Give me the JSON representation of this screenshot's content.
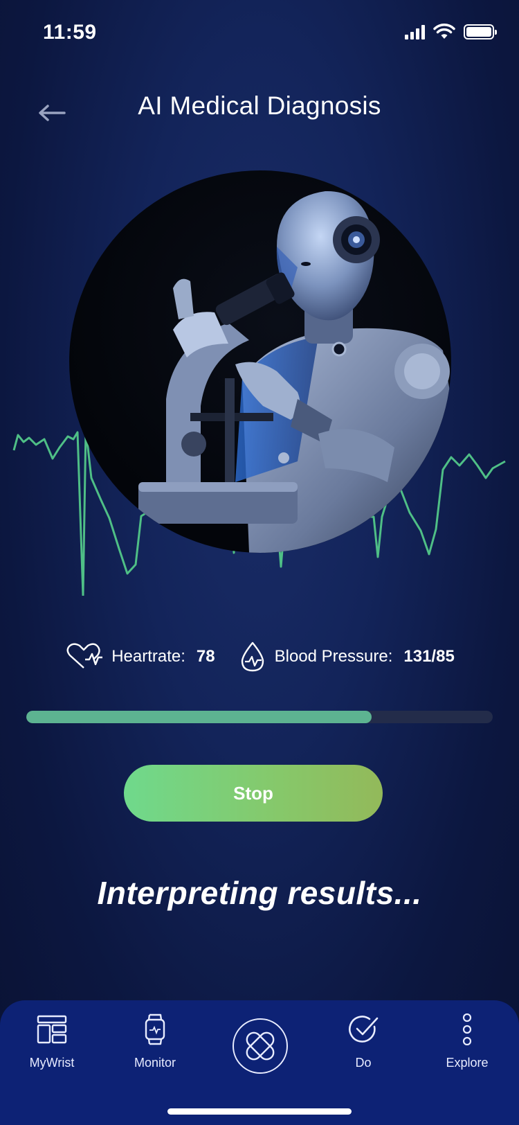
{
  "status_bar": {
    "time": "11:59"
  },
  "header": {
    "title": "AI Medical Diagnosis"
  },
  "vitals": {
    "heartrate_label": "Heartrate:",
    "heartrate_value": "78",
    "blood_pressure_label": "Blood Pressure:",
    "blood_pressure_value": "131/85"
  },
  "progress": {
    "fraction": 0.74
  },
  "actions": {
    "stop_label": "Stop"
  },
  "status_message": "Interpreting results...",
  "tab_bar": {
    "items": [
      {
        "label": "MyWrist",
        "icon": "dashboard-icon"
      },
      {
        "label": "Monitor",
        "icon": "smartwatch-icon"
      },
      {
        "label": "",
        "icon": "bandage-icon"
      },
      {
        "label": "Do",
        "icon": "check-circle-icon"
      },
      {
        "label": "Explore",
        "icon": "more-vertical-icon"
      }
    ]
  },
  "colors": {
    "background": "#13245a",
    "accent_green": "#5db391",
    "ecg_line": "#4fbf86",
    "tab_bar": "#0d2275",
    "button_gradient_start": "#6fd98c",
    "button_gradient_end": "#93b95a"
  },
  "icons": {
    "back": "arrow-left-icon",
    "heartrate": "heart-pulse-icon",
    "blood_pressure": "drop-pulse-icon",
    "hero_image": "robot-with-microscope"
  }
}
